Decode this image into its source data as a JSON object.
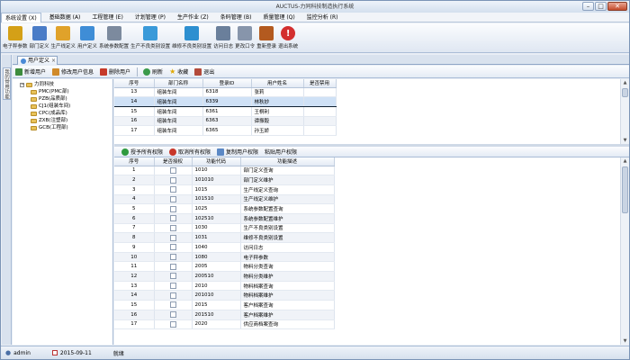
{
  "window": {
    "title": "AUCTUS-力同科技制造执行系统"
  },
  "menu": [
    {
      "label": "系统设置 (X)",
      "active": true
    },
    {
      "label": "基础数据 (A)"
    },
    {
      "label": "工程管理 (E)"
    },
    {
      "label": "计划管理 (P)"
    },
    {
      "label": "生产作业 (Z)"
    },
    {
      "label": "条码管理 (B)"
    },
    {
      "label": "质量管理 (Q)"
    },
    {
      "label": "监控分析 (R)"
    }
  ],
  "ribbon": [
    {
      "label": "电子秤参数",
      "icon": "scale-icon",
      "color": "#d4a017"
    },
    {
      "label": "部门定义",
      "icon": "department-icon",
      "color": "#4a7cc7"
    },
    {
      "label": "生产线定义",
      "icon": "production-line-icon",
      "color": "#e0a22a"
    },
    {
      "label": "用户定义",
      "icon": "user-icon",
      "color": "#3f8dd6"
    },
    {
      "label": "系统参数配置",
      "icon": "wrench-icon",
      "color": "#7c8a9e"
    },
    {
      "label": "生产不良类别设置",
      "icon": "defect-category-icon",
      "color": "#3a9ad9"
    },
    {
      "label": "维修不良类别设置",
      "icon": "repair-category-icon",
      "color": "#2d8fd0"
    },
    {
      "label": "访问日志",
      "icon": "log-icon",
      "color": "#6a7f9b"
    },
    {
      "label": "更改口令",
      "icon": "lock-icon",
      "color": "#8795ab"
    },
    {
      "label": "重新登录",
      "icon": "relogin-icon",
      "color": "#b35a1f"
    },
    {
      "label": "退出系统",
      "icon": "exit-icon",
      "color": "#d32f2f"
    }
  ],
  "side": {
    "vtab": "我的常用功能"
  },
  "doc": {
    "tab": "用户定义"
  },
  "toolbar": {
    "add": "新增用户",
    "edit": "修改用户信息",
    "delete": "删除用户",
    "refresh": "刷新",
    "favorite": "收藏",
    "exit": "退出"
  },
  "tree": {
    "root": "力同科技",
    "children": [
      "PMC(PMC部)",
      "PZB(品质部)",
      "CJ1(组装车间)",
      "CPC(成品库)",
      "ZXB(注塑部)",
      "GCB(工程部)"
    ]
  },
  "users": {
    "headers": [
      "序号",
      "部门名称",
      "登录ID",
      "用户姓名",
      "是否禁用"
    ],
    "rows": [
      [
        "13",
        "组装车间",
        "6318",
        "张莉",
        ""
      ],
      [
        "14",
        "组装车间",
        "6339",
        "林秋妙",
        ""
      ],
      [
        "15",
        "组装车间",
        "6361",
        "王桐利",
        ""
      ],
      [
        "16",
        "组装车间",
        "6363",
        "谭振毅",
        ""
      ],
      [
        "17",
        "组装车间",
        "6365",
        "孙玉娇",
        ""
      ]
    ],
    "selected_index": 1
  },
  "perm_toolbar": {
    "grant_all": "授予所有权限",
    "revoke_all": "取消所有权限",
    "copy": "复制用户权限",
    "paste": "粘贴用户权限"
  },
  "perms": {
    "headers": [
      "序号",
      "是否授权",
      "功能代码",
      "功能描述"
    ],
    "rows": [
      [
        "1",
        "1010",
        "部门定义查询"
      ],
      [
        "2",
        "101010",
        "部门定义维护"
      ],
      [
        "3",
        "1015",
        "生产线定义查询"
      ],
      [
        "4",
        "101510",
        "生产线定义维护"
      ],
      [
        "5",
        "1025",
        "系统参数配置查询"
      ],
      [
        "6",
        "102510",
        "系统参数配置维护"
      ],
      [
        "7",
        "1030",
        "生产不良类别设置"
      ],
      [
        "8",
        "1031",
        "维修不良类别设置"
      ],
      [
        "9",
        "1040",
        "访问日志"
      ],
      [
        "10",
        "1080",
        "电子秤参数"
      ],
      [
        "11",
        "2005",
        "物料分类查询"
      ],
      [
        "12",
        "200510",
        "物料分类维护"
      ],
      [
        "13",
        "2010",
        "物料档案查询"
      ],
      [
        "14",
        "201010",
        "物料档案维护"
      ],
      [
        "15",
        "2015",
        "客户档案查询"
      ],
      [
        "16",
        "201510",
        "客户档案维护"
      ],
      [
        "17",
        "2020",
        "供应商档案查询"
      ]
    ]
  },
  "status": {
    "user": "admin",
    "date": "2015-09-11",
    "state": "就绪"
  }
}
